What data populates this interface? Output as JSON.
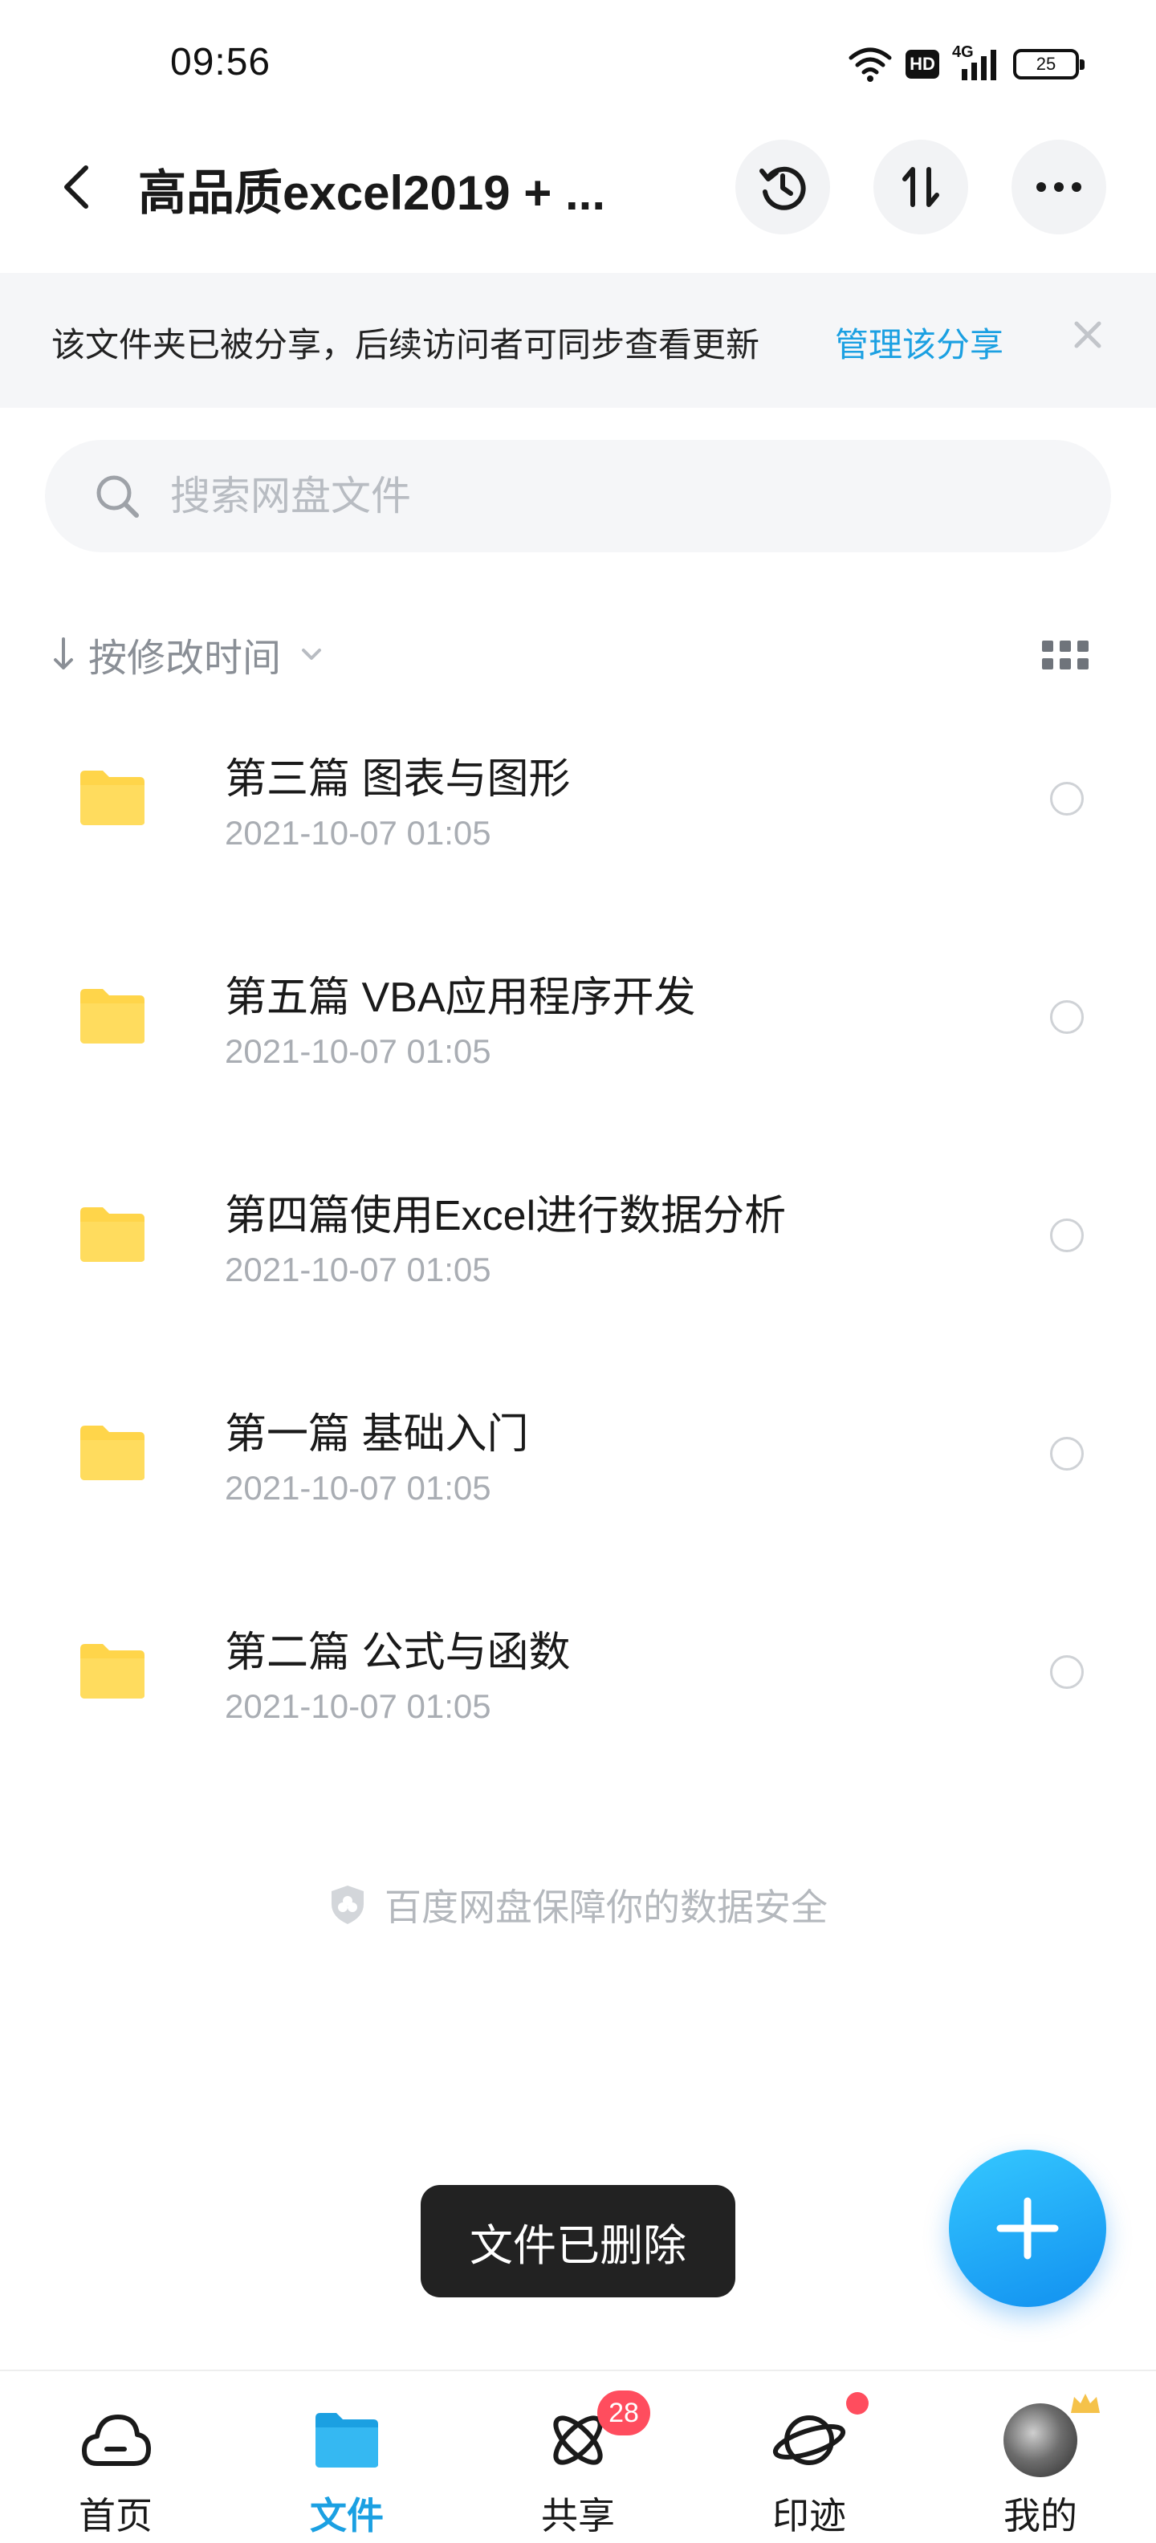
{
  "status_bar": {
    "time": "09:56",
    "hd": "HD",
    "network": "4G",
    "battery": "25"
  },
  "header": {
    "title": "高品质excel2019 + ...",
    "icons": [
      "back-icon",
      "history-icon",
      "sort-transfer-icon",
      "more-icon"
    ]
  },
  "banner": {
    "text": "该文件夹已被分享，后续访问者可同步查看更新",
    "link": "管理该分享"
  },
  "search": {
    "placeholder": "搜索网盘文件"
  },
  "sort": {
    "label": "按修改时间"
  },
  "files": [
    {
      "name": "第三篇 图表与图形",
      "date": "2021-10-07  01:05"
    },
    {
      "name": "第五篇 VBA应用程序开发",
      "date": "2021-10-07  01:05"
    },
    {
      "name": "第四篇使用Excel进行数据分析",
      "date": "2021-10-07  01:05"
    },
    {
      "name": "第一篇 基础入门",
      "date": "2021-10-07  01:05"
    },
    {
      "name": "第二篇  公式与函数",
      "date": "2021-10-07  01:05"
    }
  ],
  "footer_note": "百度网盘保障你的数据安全",
  "toast": "文件已删除",
  "nav": [
    {
      "label": "首页"
    },
    {
      "label": "文件"
    },
    {
      "label": "共享",
      "badge": "28"
    },
    {
      "label": "印迹"
    },
    {
      "label": "我的"
    }
  ],
  "colors": {
    "accent": "#1ba0e2",
    "folder": "#ffd54a",
    "badge": "#ff4d5e",
    "toast_bg": "#222222"
  }
}
